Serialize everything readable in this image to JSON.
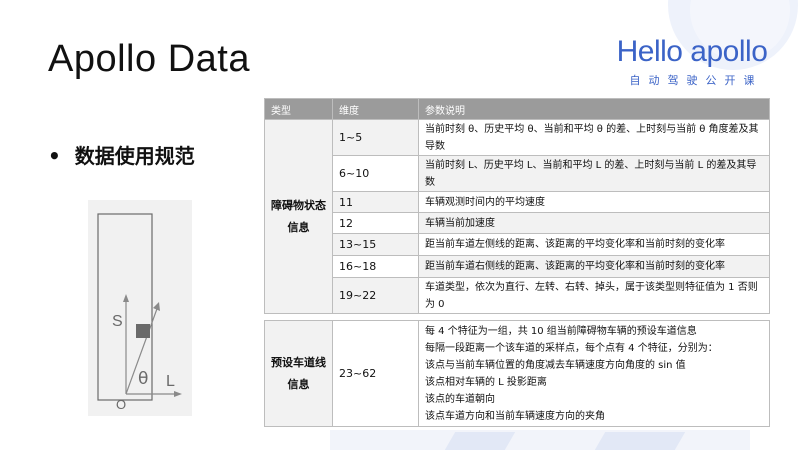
{
  "slide": {
    "title": "Apollo Data"
  },
  "logo": {
    "main": "Hello apollo",
    "sub": "自动驾驶公开课"
  },
  "bullet": {
    "dot": "•",
    "text": "数据使用规范"
  },
  "figure": {
    "s_label": "S",
    "theta_label": "θ",
    "l_label": "L",
    "o_label": "O"
  },
  "table_header": {
    "type": "类型",
    "dim": "维度",
    "desc": "参数说明"
  },
  "obstacle": {
    "group": "障碍物状态信息",
    "rows": [
      {
        "dim": "1~5",
        "desc": "当前时刻 θ、历史平均 θ、当前和平均 θ 的差、上时刻与当前 θ 角度差及其导数"
      },
      {
        "dim": "6~10",
        "desc": "当前时刻 L、历史平均 L、当前和平均 L 的差、上时刻与当前 L 的差及其导数"
      },
      {
        "dim": "11",
        "desc": "车辆观测时间内的平均速度"
      },
      {
        "dim": "12",
        "desc": "车辆当前加速度"
      },
      {
        "dim": "13~15",
        "desc": "距当前车道左侧线的距离、该距离的平均变化率和当前时刻的变化率"
      },
      {
        "dim": "16~18",
        "desc": "距当前车道右侧线的距离、该距离的平均变化率和当前时刻的变化率"
      },
      {
        "dim": "19~22",
        "desc": "车道类型，依次为直行、左转、右转、掉头，属于该类型则特征值为 1 否则为 0"
      }
    ]
  },
  "lane": {
    "group": "预设车道线信息",
    "dim": "23~62",
    "lines": [
      "每 4 个特征为一组，共 10 组当前障碍物车辆的预设车道信息",
      "每隔一段距离一个该车道的采样点，每个点有 4 个特征，分别为：",
      "该点与当前车辆位置的角度减去车辆速度方向角度的 sin 值",
      "该点相对车辆的 L 投影距离",
      "该点的车道朝向",
      "该点车道方向和当前车辆速度方向的夹角"
    ]
  },
  "colors": {
    "brand": "#3b63c7",
    "header_bg": "#9b9b9b",
    "row_alt": "#f2f2f2",
    "figure_box": "#6a6a6a"
  }
}
